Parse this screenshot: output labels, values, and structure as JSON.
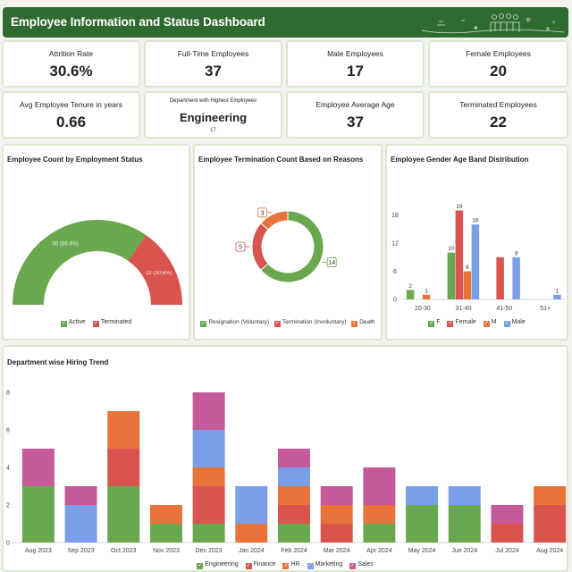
{
  "header": {
    "title": "Employee Information and Status Dashboard"
  },
  "kpis": [
    {
      "label": "Attrition Rate",
      "value": "30.6%"
    },
    {
      "label": "Full-Time Employees",
      "value": "37"
    },
    {
      "label": "Male Employees",
      "value": "17"
    },
    {
      "label": "Female Employees",
      "value": "20"
    },
    {
      "label": "Avg Employee Tenure in years",
      "value": "0.66"
    },
    {
      "label": "Department with Highest Employees",
      "value": "Engineering",
      "sub": "17"
    },
    {
      "label": "Employee Average Age",
      "value": "37"
    },
    {
      "label": "Terminated Employees",
      "value": "22"
    }
  ],
  "colors": {
    "green": "#6aa84f",
    "red": "#d9534f",
    "orange": "#e8743b",
    "blue": "#7b9ee8",
    "pink": "#c55a9a",
    "header": "#2f6b2f"
  },
  "icons": {
    "header_decoration": "people-group-icon",
    "legend_check": "checkmark-icon"
  },
  "chart_data": [
    {
      "type": "gauge",
      "title": "Employee Count by Employment Status",
      "categories": [
        "Active",
        "Terminated"
      ],
      "values": [
        50,
        22
      ],
      "data_labels": [
        "50 (69.4%)",
        "22 (30.6%)"
      ],
      "legend_position": "bottom"
    },
    {
      "type": "donut",
      "title": "Employee Termination Count Based on Reasons",
      "categories": [
        "Resignation (Voluntary)",
        "Termination (Involuntary)",
        "Death"
      ],
      "values": [
        14,
        5,
        3
      ],
      "legend_position": "bottom"
    },
    {
      "type": "bar",
      "title": "Employee Gender Age Band Distribution",
      "categories": [
        "20-30",
        "31-40",
        "41-50",
        "51+"
      ],
      "series": [
        {
          "name": "F",
          "values": [
            2,
            10,
            0,
            0
          ]
        },
        {
          "name": "Female",
          "values": [
            0,
            19,
            9,
            0
          ]
        },
        {
          "name": "M",
          "values": [
            1,
            6,
            0,
            0
          ]
        },
        {
          "name": "Male",
          "values": [
            0,
            16,
            9,
            1
          ]
        }
      ],
      "data_labels": [
        [
          "2",
          "10",
          "",
          ""
        ],
        [
          "",
          "19",
          "",
          ""
        ],
        [
          "1",
          "6",
          "",
          ""
        ],
        [
          "",
          "16",
          "9",
          "1"
        ]
      ],
      "yticks": [
        0,
        6,
        12,
        18
      ],
      "ylim": [
        0,
        21
      ],
      "grid": false,
      "legend_position": "bottom"
    },
    {
      "type": "bar",
      "stacked": true,
      "title": "Department wise Hiring Trend",
      "categories": [
        "Aug 2023",
        "Sep 2023",
        "Oct 2023",
        "Nov 2023",
        "Dec 2023",
        "Jan 2024",
        "Feb 2024",
        "Mar 2024",
        "Apr 2024",
        "May 2024",
        "Jun 2024",
        "Jul 2024",
        "Aug 2024"
      ],
      "series": [
        {
          "name": "Engineering",
          "values": [
            3,
            0,
            3,
            1,
            1,
            0,
            1,
            0,
            1,
            2,
            2,
            0,
            0
          ]
        },
        {
          "name": "Finance",
          "values": [
            0,
            0,
            2,
            0,
            2,
            0,
            1,
            1,
            0,
            0,
            0,
            1,
            2
          ]
        },
        {
          "name": "HR",
          "values": [
            0,
            0,
            2,
            1,
            1,
            1,
            1,
            1,
            1,
            0,
            0,
            0,
            1
          ]
        },
        {
          "name": "Marketing",
          "values": [
            0,
            2,
            0,
            0,
            2,
            2,
            1,
            0,
            0,
            1,
            1,
            0,
            0
          ]
        },
        {
          "name": "Sales",
          "values": [
            2,
            1,
            0,
            0,
            2,
            0,
            1,
            1,
            2,
            0,
            0,
            1,
            0
          ]
        }
      ],
      "yticks": [
        0,
        2,
        4,
        6,
        8
      ],
      "ylim": [
        0,
        8
      ],
      "grid": false,
      "legend_position": "bottom"
    }
  ]
}
